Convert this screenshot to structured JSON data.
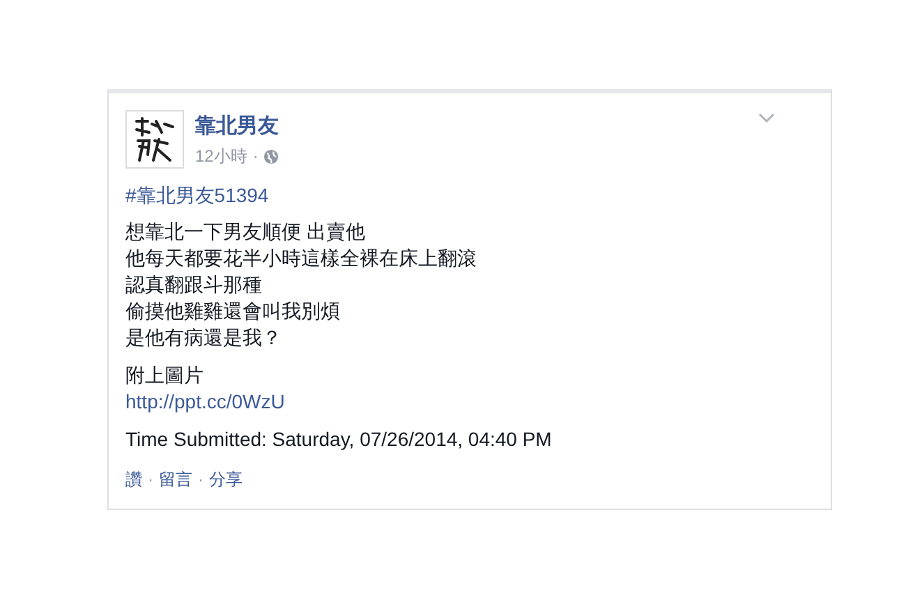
{
  "post": {
    "author": "靠北男友",
    "time": "12小時",
    "separator": "·",
    "hashtag": "#靠北男友51394",
    "body_lines": [
      "想靠北一下男友順便 出賣他",
      "他每天都要花半小時這樣全裸在床上翻滾",
      "認真翻跟斗那種",
      "偷摸他雞雞還會叫我別煩",
      "是他有病還是我？"
    ],
    "attachment_label": "附上圖片",
    "link": "http://ppt.cc/0WzU",
    "submitted": "Time Submitted: Saturday, 07/26/2014, 04:40 PM",
    "actions": [
      {
        "label": "讚"
      },
      {
        "label": "留言"
      },
      {
        "label": "分享"
      }
    ]
  }
}
